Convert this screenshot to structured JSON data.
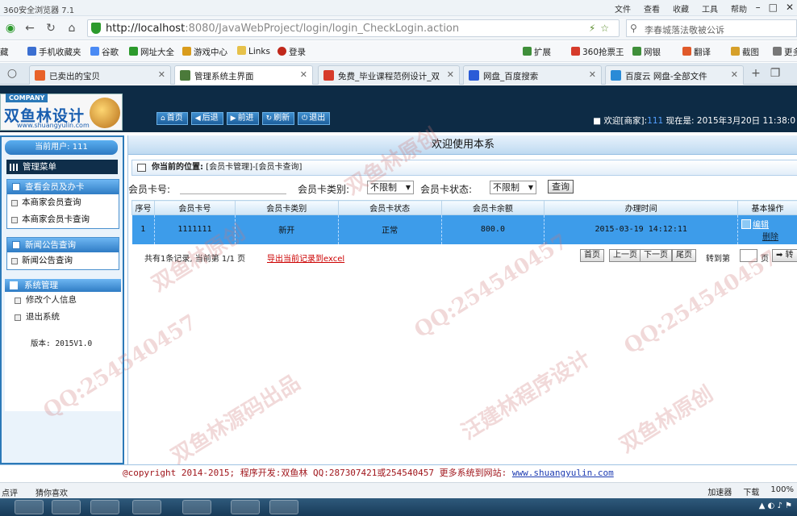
{
  "browser": {
    "app_name": "360安全浏览器 7.1",
    "menus": [
      "文件",
      "查看",
      "收藏",
      "工具",
      "帮助"
    ],
    "url_host": "http://localhost",
    "url_rest": ":8080/JavaWebProject/login/login_CheckLogin.action",
    "search_text": "李春城落法敬被公诉",
    "bookmarks": [
      "藏",
      "手机收藏夹",
      "谷歌",
      "网址大全",
      "游戏中心",
      "Links",
      "登录"
    ],
    "bookmarks_right": [
      "扩展",
      "360抢票王",
      "网银",
      "翻译",
      "截图",
      "更多"
    ],
    "tabs": [
      {
        "label": "已卖出的宝贝",
        "color": "#e8622a"
      },
      {
        "label": "管理系统主界面",
        "color": "#4b7a3a"
      },
      {
        "label": "免费_毕业课程范例设计_双",
        "color": "#d63b2b"
      },
      {
        "label": "网盘_百度搜索",
        "color": "#2a5bd7"
      },
      {
        "label": "百度云 网盘-全部文件",
        "color": "#2a8bd7"
      }
    ],
    "status_left": "点评",
    "status_mid": "猜你喜欢",
    "status_right": [
      "加速器",
      "下载",
      "100%"
    ]
  },
  "header": {
    "company": "COMPANY",
    "brand": "双鱼林设计",
    "site": "www.shuangyulin.com",
    "nav": [
      {
        "icon": "home-icon",
        "glyph": "⌂",
        "label": "首页"
      },
      {
        "icon": "back-icon",
        "glyph": "◀",
        "label": "后退"
      },
      {
        "icon": "forward-icon",
        "glyph": "▶",
        "label": "前进"
      },
      {
        "icon": "refresh-icon",
        "glyph": "↻",
        "label": "刷新"
      },
      {
        "icon": "power-icon",
        "glyph": "⏻",
        "label": "退出"
      }
    ],
    "welcome_prefix": "欢迎[商家]:",
    "welcome_user": "111",
    "welcome_suffix": " 现在是: 2015年3月20日 11:38:0"
  },
  "sidebar": {
    "current_user": "当前用户: 111",
    "menu_title": "管理菜单",
    "groups": [
      {
        "title": "查看会员及办卡",
        "items": [
          "本商家会员查询",
          "本商家会员卡查询"
        ]
      },
      {
        "title": "新闻公告查询",
        "items": [
          "新闻公告查询"
        ]
      }
    ],
    "system": {
      "title": "系统管理",
      "items": [
        "修改个人信息",
        "退出系统"
      ]
    },
    "version": "版本: 2015V1.0"
  },
  "main": {
    "welcome_title": "欢迎使用本系",
    "location_label": "你当前的位置:",
    "location_path": "[会员卡管理]-[会员卡查询]",
    "search": {
      "card_no_label": "会员卡号:",
      "card_no_value": "",
      "type_label": "会员卡类别:",
      "type_value": "不限制",
      "status_label": "会员卡状态:",
      "status_value": "不限制",
      "query_button": "查询"
    },
    "table": {
      "headers": [
        "序号",
        "会员卡号",
        "会员卡类别",
        "会员卡状态",
        "会员卡余额",
        "办理时间",
        "基本操作"
      ],
      "rows": [
        {
          "index": "1",
          "card_no": "1111111",
          "type": "新开",
          "status": "正常",
          "balance": "800.0",
          "time": "2015-03-19 14:12:11",
          "edit": "编辑",
          "delete": "删除"
        }
      ]
    },
    "pager": {
      "info": "共有1条记录, 当前第 1/1 页",
      "excel": "导出当前记录到excel",
      "first": "首页",
      "prev": "上一页",
      "next": "下一页",
      "last": "尾页",
      "goto": "转到第",
      "page_unit": "页",
      "go": "➡ 转"
    }
  },
  "footer": {
    "copyright": "@copyright 2014-2015; 程序开发:双鱼林",
    "qq": "QQ:287307421或254540457",
    "more": "更多系统到网站:",
    "site": "www.shuangyulin.com"
  },
  "watermark": {
    "texts": [
      "双鱼林原创",
      "QQ:254540457",
      "汪建林程序设计",
      "双鱼林源码出品"
    ]
  }
}
